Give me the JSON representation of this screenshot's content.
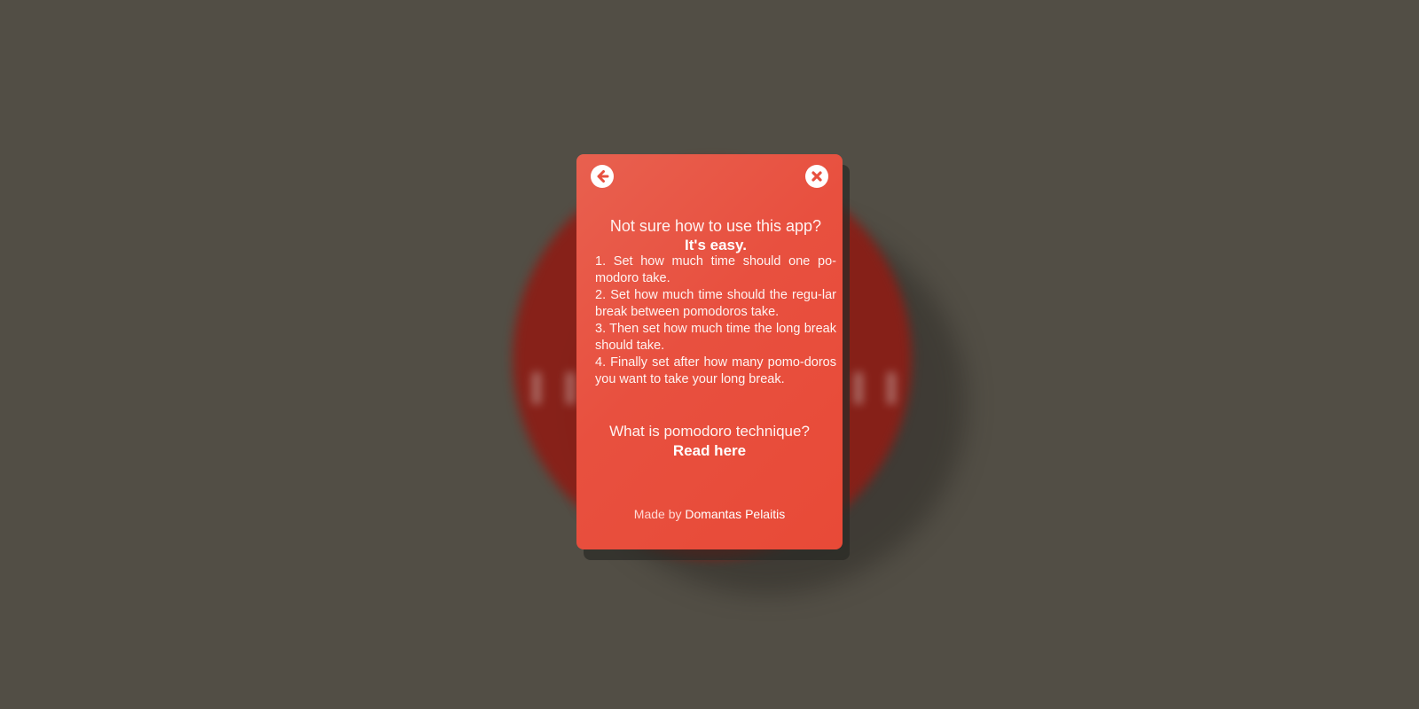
{
  "background": {
    "color": "#524e45",
    "circle_color": "#8a1f17"
  },
  "card": {
    "color": "#e8503f",
    "back_icon": "arrow-left-circle-icon",
    "close_icon": "close-circle-icon"
  },
  "intro": {
    "question": "Not sure how to use this app?",
    "easy": "It's easy."
  },
  "steps": [
    "1. Set how much time should one po-modoro take.",
    "2. Set how much time should the regu-lar break between pomodoros take.",
    "3. Then set how much time the long break should take.",
    "4. Finally set after how many pomo-doros you want to take your long break."
  ],
  "technique": {
    "question": "What is pomodoro technique?",
    "link": "Read here"
  },
  "footer": {
    "made_by": "Made by",
    "author": "Domantas Pelaitis"
  }
}
